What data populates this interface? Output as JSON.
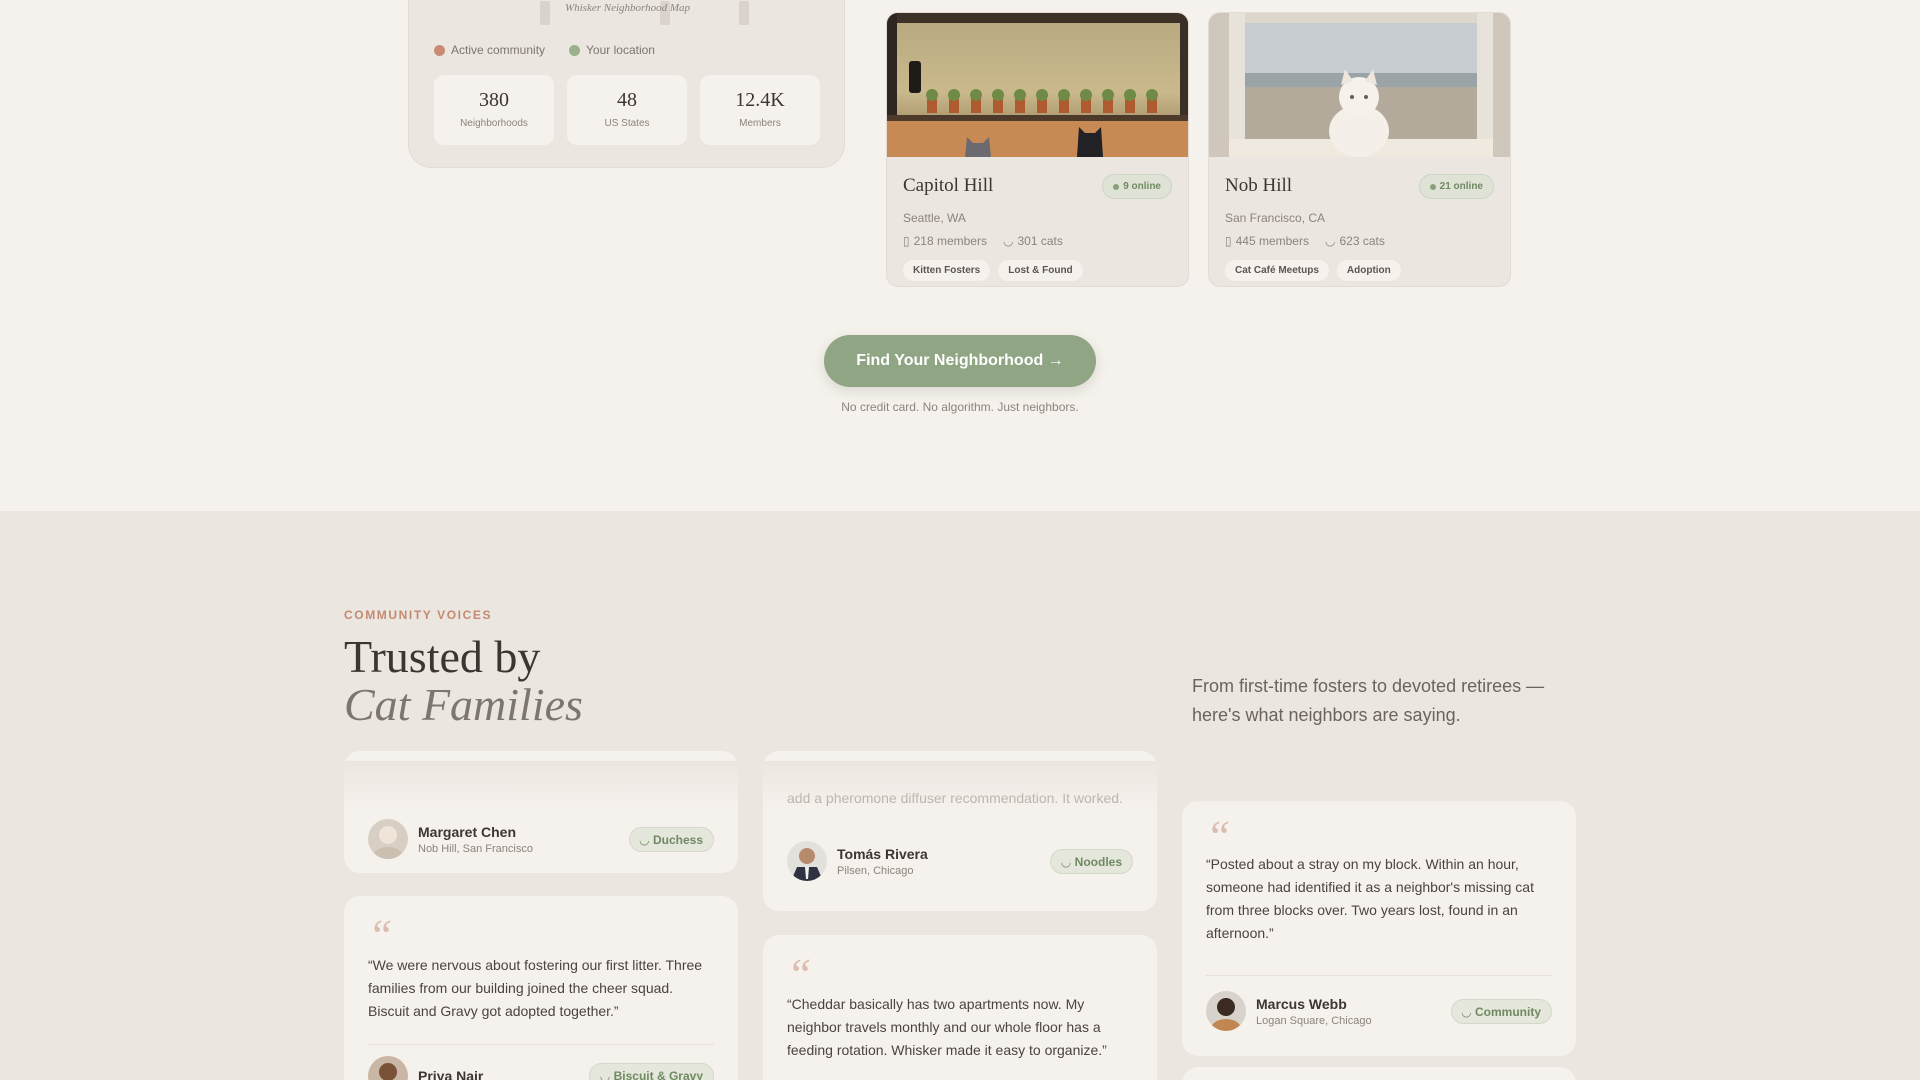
{
  "map": {
    "caption": "Whisker Neighborhood Map",
    "legend": [
      {
        "label": "Active community",
        "color": "#c98b73"
      },
      {
        "label": "Your location",
        "color": "#9bb08c"
      }
    ],
    "stats": [
      {
        "value": "380",
        "label": "Neighborhoods"
      },
      {
        "value": "48",
        "label": "US States"
      },
      {
        "value": "12.4K",
        "label": "Members"
      }
    ]
  },
  "neighborhoods": [
    {
      "name": "Capitol Hill",
      "city": "Seattle, WA",
      "online": "9 online",
      "members": "218 members",
      "cats": "301 cats",
      "tags": [
        "Kitten Fosters",
        "Lost & Found"
      ]
    },
    {
      "name": "Nob Hill",
      "city": "San Francisco, CA",
      "online": "21 online",
      "members": "445 members",
      "cats": "623 cats",
      "tags": [
        "Cat Café Meetups",
        "Adoption"
      ]
    }
  ],
  "cta": {
    "label": "Find Your Neighborhood →",
    "note": "No credit card. No algorithm. Just neighbors."
  },
  "voices": {
    "eyebrow": "COMMUNITY VOICES",
    "title_line1": "Trusted by",
    "title_line2": "Cat Families",
    "intro": "From first-time fosters to devoted retirees — here's what neighbors are saying.",
    "testimonials": [
      {
        "name": "Margaret Chen",
        "location": "Nob Hill, San Francisco",
        "pet": "Duchess"
      },
      {
        "quote": "“We were nervous about fostering our first litter. Three families from our building joined the cheer squad. Biscuit and Gravy got adopted together.”",
        "name": "Priya Nair",
        "pet": "Biscuit & Gravy"
      },
      {
        "quote": "add a pheromone diffuser recommendation. It worked.",
        "name": "Tomás Rivera",
        "location": "Pilsen, Chicago",
        "pet": "Noodles"
      },
      {
        "quote": "“Cheddar basically has two apartments now. My neighbor travels monthly and our whole floor has a feeding rotation. Whisker made it easy to organize.”"
      },
      {
        "quote": "“Posted about a stray on my block. Within an hour, someone had identified it as a neighbor's missing cat from three blocks over. Two years lost, found in an afternoon.”",
        "name": "Marcus Webb",
        "location": "Logan Square, Chicago",
        "pet": "Community"
      }
    ]
  }
}
